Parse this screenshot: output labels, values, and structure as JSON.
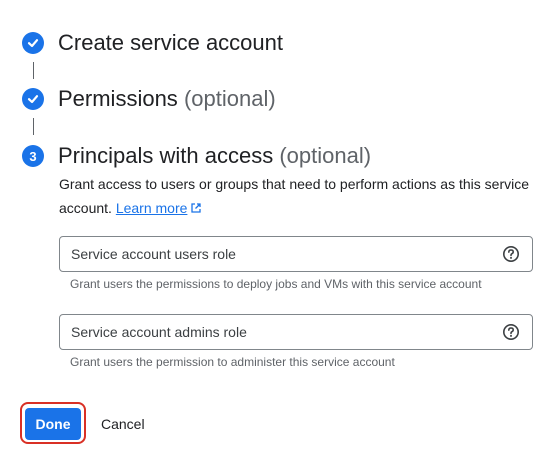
{
  "steps": [
    {
      "title": "Create service account",
      "optional": "",
      "state": "complete",
      "icon": "check-icon"
    },
    {
      "title": "Permissions",
      "optional": "(optional)",
      "state": "complete",
      "icon": "check-icon"
    },
    {
      "title": "Principals with access",
      "optional": "(optional)",
      "state": "current",
      "number": "3"
    }
  ],
  "description": {
    "text": "Grant access to users or groups that need to perform actions as this service account.",
    "link_label": "Learn more",
    "link_icon": "external-link-icon"
  },
  "fields": [
    {
      "label": "Service account users role",
      "hint": "Grant users the permissions to deploy jobs and VMs with this service account",
      "icon": "help-icon"
    },
    {
      "label": "Service account admins role",
      "hint": "Grant users the permission to administer this service account",
      "icon": "help-icon"
    }
  ],
  "actions": {
    "done_label": "Done",
    "cancel_label": "Cancel"
  },
  "colors": {
    "accent": "#1a73e8",
    "highlight": "#d93025",
    "muted": "#5f6368"
  }
}
